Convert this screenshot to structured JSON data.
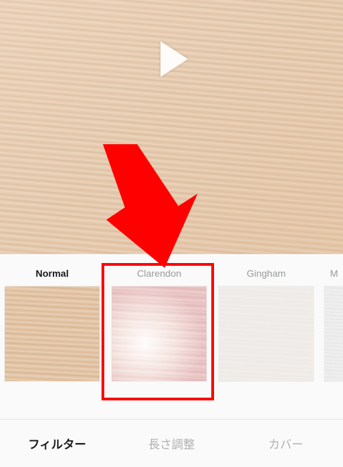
{
  "filters": {
    "items": [
      {
        "name": "Normal",
        "selected": true
      },
      {
        "name": "Clarendon",
        "selected": false
      },
      {
        "name": "Gingham",
        "selected": false
      },
      {
        "name": "M",
        "selected": false
      }
    ]
  },
  "tabs": {
    "filter": "フィルター",
    "trim": "長さ調整",
    "cover": "カバー"
  },
  "annotation": {
    "highlighted_filter_index": 1
  }
}
